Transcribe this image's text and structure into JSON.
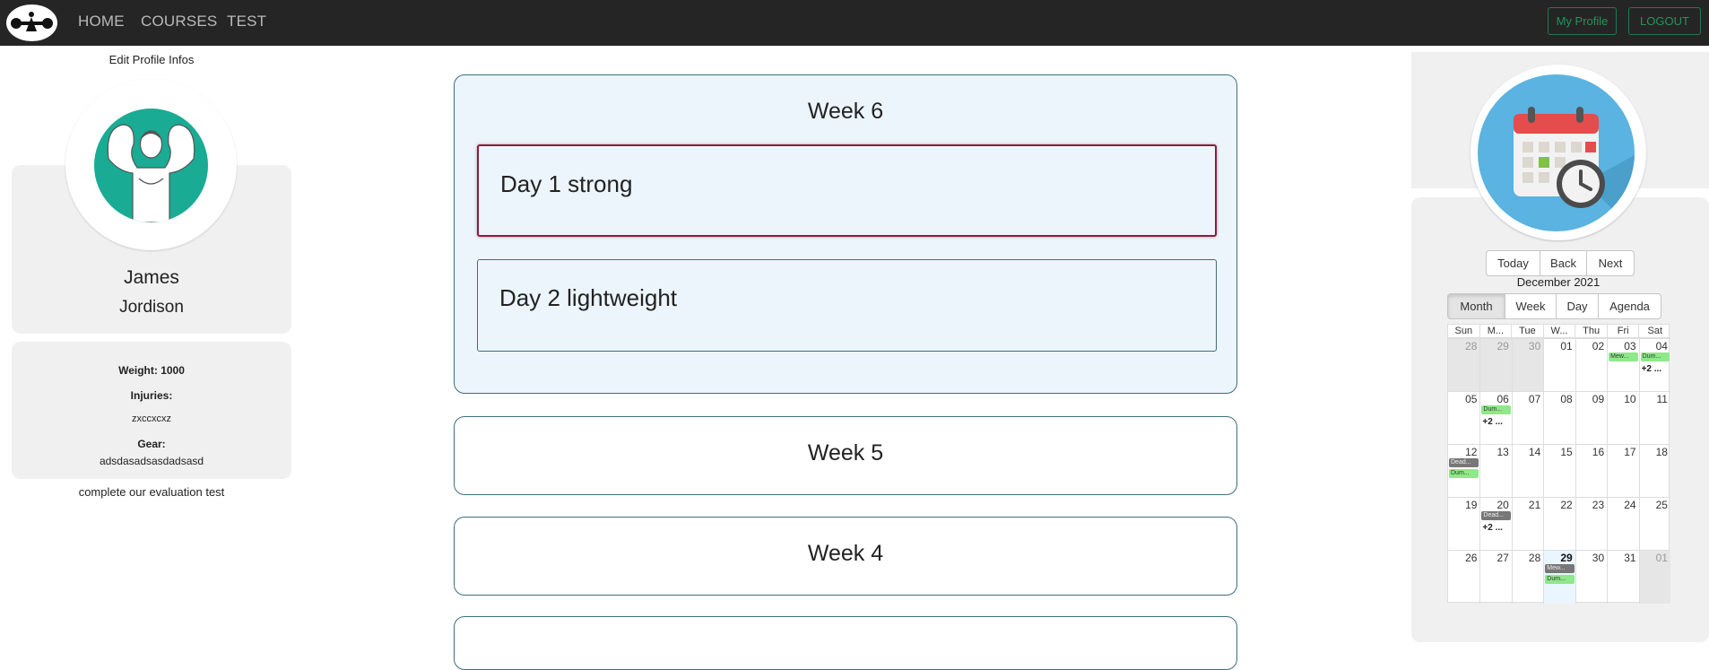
{
  "nav": {
    "links": [
      "HOME",
      "COURSES",
      "TEST"
    ],
    "profile_btn": "My Profile",
    "logout_btn": "LOGOUT"
  },
  "profile": {
    "edit_link": "Edit Profile Infos",
    "first_name": "James",
    "last_name": "Jordison",
    "weight": "Weight: 1000",
    "injuries_label": "Injuries:",
    "injuries_value": "zxccxcxz",
    "gear_label": "Gear:",
    "gear_value": "adsdasadsasdadsasd",
    "eval_link": "complete our evaluation test"
  },
  "weeks": [
    {
      "title": "Week 6",
      "days": [
        "Day 1 strong",
        "Day 2 lightweight"
      ]
    },
    {
      "title": "Week 5"
    },
    {
      "title": "Week 4"
    }
  ],
  "calendar": {
    "nav_buttons": [
      "Today",
      "Back",
      "Next"
    ],
    "label": "December 2021",
    "views": [
      "Month",
      "Week",
      "Day",
      "Agenda"
    ],
    "active_view": "Month",
    "dow": [
      "Sun",
      "M...",
      "Tue",
      "W...",
      "Thu",
      "Fri",
      "Sat"
    ],
    "rows": [
      [
        {
          "d": "28",
          "off": true
        },
        {
          "d": "29",
          "off": true
        },
        {
          "d": "30",
          "off": true
        },
        {
          "d": "01"
        },
        {
          "d": "02"
        },
        {
          "d": "03",
          "ev": [
            [
              "Mew...",
              "green"
            ]
          ]
        },
        {
          "d": "04",
          "ev": [
            [
              "Dum...",
              "green"
            ]
          ],
          "more": "+2 ..."
        }
      ],
      [
        {
          "d": "05"
        },
        {
          "d": "06",
          "ev": [
            [
              "Dum...",
              "green"
            ]
          ],
          "more": "+2 ..."
        },
        {
          "d": "07"
        },
        {
          "d": "08"
        },
        {
          "d": "09"
        },
        {
          "d": "10"
        },
        {
          "d": "11"
        }
      ],
      [
        {
          "d": "12",
          "ev": [
            [
              "Dead...",
              "gray"
            ],
            [
              "Dum...",
              "green"
            ]
          ]
        },
        {
          "d": "13"
        },
        {
          "d": "14"
        },
        {
          "d": "15"
        },
        {
          "d": "16"
        },
        {
          "d": "17"
        },
        {
          "d": "18"
        }
      ],
      [
        {
          "d": "19"
        },
        {
          "d": "20",
          "ev": [
            [
              "Dead...",
              "gray"
            ]
          ],
          "more": "+2 ..."
        },
        {
          "d": "21"
        },
        {
          "d": "22"
        },
        {
          "d": "23"
        },
        {
          "d": "24"
        },
        {
          "d": "25"
        }
      ],
      [
        {
          "d": "26"
        },
        {
          "d": "27"
        },
        {
          "d": "28"
        },
        {
          "d": "29",
          "today": true,
          "ev": [
            [
              "Mew...",
              "gray"
            ],
            [
              "Dum...",
              "green"
            ]
          ]
        },
        {
          "d": "30"
        },
        {
          "d": "31"
        },
        {
          "d": "01",
          "off": true
        }
      ]
    ]
  },
  "colors": {
    "navbar": "#252525",
    "accent_green": "#25935e",
    "panel_gray": "#f0f0f0",
    "week_open_bg": "#ecf5fc",
    "active_day_border": "#8b1c3d",
    "avatar_teal": "#1aab94",
    "calendar_blue": "#5ab3e0"
  }
}
